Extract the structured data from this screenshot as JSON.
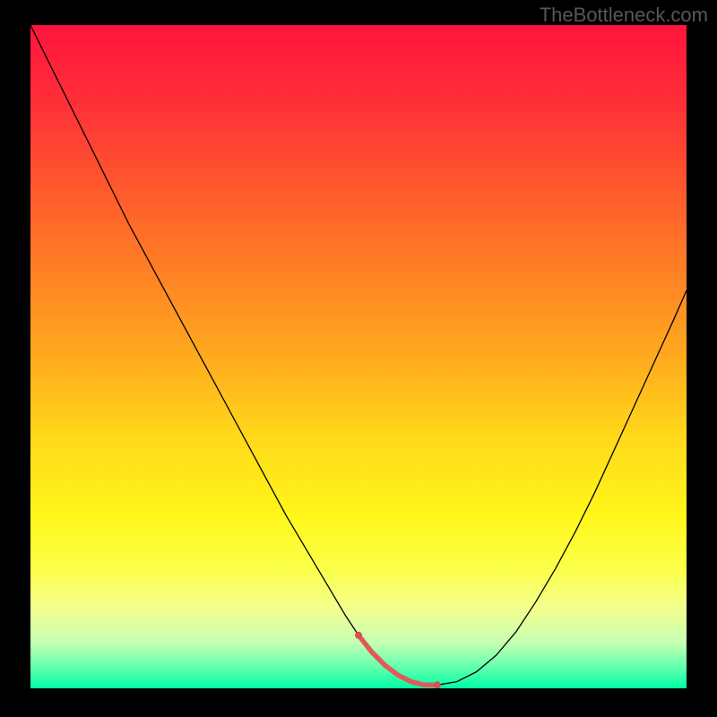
{
  "watermark": "TheBottleneck.com",
  "chart_data": {
    "type": "line",
    "title": "",
    "xlabel": "",
    "ylabel": "",
    "xlim": [
      0,
      100
    ],
    "ylim": [
      0,
      100
    ],
    "grid": false,
    "legend": false,
    "background_gradient": {
      "stops": [
        {
          "offset": 0.0,
          "color": "#ff143d"
        },
        {
          "offset": 0.12,
          "color": "#ff3038"
        },
        {
          "offset": 0.25,
          "color": "#ff5a2c"
        },
        {
          "offset": 0.38,
          "color": "#ff8324"
        },
        {
          "offset": 0.5,
          "color": "#ffaa1e"
        },
        {
          "offset": 0.62,
          "color": "#ffd81a"
        },
        {
          "offset": 0.74,
          "color": "#fff719"
        },
        {
          "offset": 0.82,
          "color": "#fcff4a"
        },
        {
          "offset": 0.88,
          "color": "#f2ff8e"
        },
        {
          "offset": 0.93,
          "color": "#c7ffb2"
        },
        {
          "offset": 0.97,
          "color": "#5effad"
        },
        {
          "offset": 1.0,
          "color": "#00ffa5"
        }
      ]
    },
    "series": [
      {
        "name": "bottleneck-curve",
        "stroke": "#000000",
        "stroke_width": 1.3,
        "x": [
          0,
          3,
          6,
          9,
          12,
          15,
          18,
          21,
          24,
          27,
          30,
          33,
          36,
          39,
          42,
          45,
          48,
          50,
          52,
          54,
          56,
          58,
          60,
          62,
          65,
          68,
          71,
          74,
          77,
          80,
          83,
          86,
          89,
          92,
          95,
          98,
          100
        ],
        "y": [
          100,
          94,
          88,
          82,
          76,
          70,
          64.5,
          59,
          53.5,
          48,
          42.5,
          37,
          31.5,
          26,
          21,
          16,
          11,
          8,
          5.5,
          3.5,
          2,
          1,
          0.5,
          0.5,
          1,
          2.5,
          5,
          8.5,
          13,
          18,
          23.5,
          29.5,
          36,
          42.5,
          49,
          55.5,
          60
        ]
      },
      {
        "name": "marker-band",
        "stroke": "#e05a5a",
        "stroke_width": 5.5,
        "linecap": "round",
        "x": [
          50,
          52,
          54,
          56,
          58,
          60,
          62
        ],
        "y": [
          8,
          5.5,
          3.5,
          2,
          1,
          0.5,
          0.5
        ]
      }
    ],
    "markers": [
      {
        "x": 50,
        "y": 8,
        "r": 4,
        "fill": "#d94f4f"
      },
      {
        "x": 62,
        "y": 0.5,
        "r": 4,
        "fill": "#d94f4f"
      }
    ]
  }
}
